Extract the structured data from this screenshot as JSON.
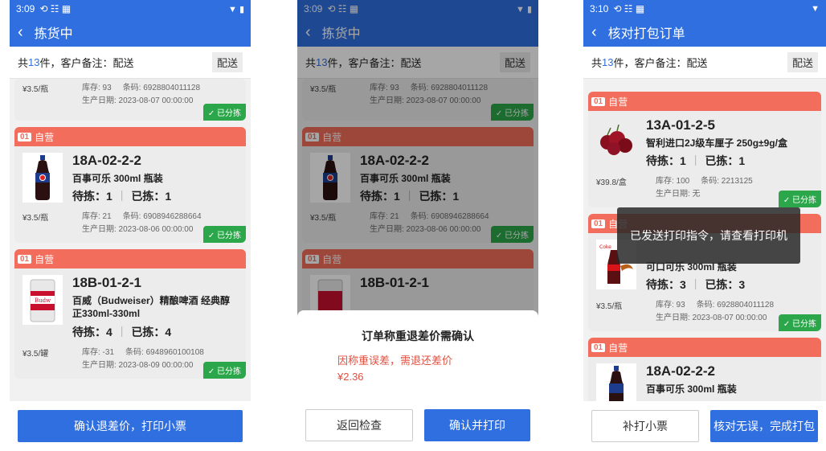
{
  "screens": [
    {
      "time": "3:09",
      "title": "拣货中",
      "summary": {
        "prefix": "共",
        "count": "13",
        "suffix": "件，客户备注：配送",
        "tag": "配送"
      },
      "partial": {
        "price": "¥3.5/瓶",
        "stock": "库存: 93",
        "barcode": "条码: 6928804011128",
        "date": "生产日期: 2023-08-07 00:00:00",
        "badge": "✓ 已分拣"
      },
      "cards": [
        {
          "num": "01",
          "store": "自营",
          "loc": "18A-02-2-2",
          "name": "百事可乐 300ml 瓶装",
          "todo": "待拣：1",
          "done": "已拣：1",
          "price": "¥3.5/瓶",
          "stock": "库存: 21",
          "barcode": "条码: 6908946288664",
          "date": "生产日期: 2023-08-06 00:00:00",
          "badge": "✓ 已分拣"
        },
        {
          "num": "01",
          "store": "自营",
          "loc": "18B-01-2-1",
          "name": "百威（Budweiser）精酿啤酒 经典醇正330ml-330ml",
          "todo": "待拣：4",
          "done": "已拣：4",
          "price": "¥3.5/罐",
          "stock": "库存: -31",
          "barcode": "条码: 6948960100108",
          "date": "生产日期: 2023-08-09 00:00:00",
          "badge": "✓ 已分拣"
        }
      ],
      "button": "确认退差价，打印小票"
    },
    {
      "time": "3:09",
      "title": "拣货中",
      "summary": {
        "prefix": "共",
        "count": "13",
        "suffix": "件，客户备注：配送",
        "tag": "配送"
      },
      "partial": {
        "price": "¥3.5/瓶",
        "stock": "库存: 93",
        "barcode": "条码: 6928804011128",
        "date": "生产日期: 2023-08-07 00:00:00",
        "badge": "✓ 已分拣"
      },
      "cards": [
        {
          "num": "01",
          "store": "自营",
          "loc": "18A-02-2-2",
          "name": "百事可乐 300ml 瓶装",
          "todo": "待拣：1",
          "done": "已拣：1",
          "price": "¥3.5/瓶",
          "stock": "库存: 21",
          "barcode": "条码: 6908946288664",
          "date": "生产日期: 2023-08-06 00:00:00",
          "badge": "✓ 已分拣"
        },
        {
          "num": "01",
          "store": "自营",
          "loc": "18B-01-2-1"
        }
      ],
      "dialog": {
        "title": "订单称重退差价需确认",
        "reason": "因称重误差，需退还差价",
        "amount": "¥2.36",
        "cancel": "返回检查",
        "confirm": "确认并打印"
      }
    },
    {
      "time": "3:10",
      "title": "核对打包订单",
      "summary": {
        "prefix": "共",
        "count": "13",
        "suffix": "件，客户备注：配送",
        "tag": "配送"
      },
      "cards": [
        {
          "num": "01",
          "store": "自营",
          "loc": "13A-01-2-5",
          "name": "智利进口2J级车厘子 250g±9g/盒",
          "todo": "待拣：1",
          "done": "已拣：1",
          "price": "¥39.8/盒",
          "stock": "库存: 100",
          "barcode": "条码: 2213125",
          "date": "生产日期: 无",
          "badge": "✓ 已分拣"
        },
        {
          "num": "01",
          "store": "自营",
          "loc": "",
          "name": "可口可乐 300ml 瓶装",
          "todo": "待拣：3",
          "done": "已拣：3",
          "price": "¥3.5/瓶",
          "stock": "库存: 93",
          "barcode": "条码: 6928804011128",
          "date": "生产日期: 2023-08-07 00:00:00",
          "badge": "✓ 已分拣"
        },
        {
          "num": "01",
          "store": "自营",
          "loc": "18A-02-2-2",
          "name": "百事可乐 300ml 瓶装"
        }
      ],
      "toast": "已发送打印指令，请查看打印机",
      "buttons": {
        "reprint": "补打小票",
        "finish": "核对无误，完成打包"
      }
    }
  ],
  "icons": {
    "back": "chevron-left-icon",
    "wifi": "wifi-icon",
    "battery": "battery-icon"
  }
}
